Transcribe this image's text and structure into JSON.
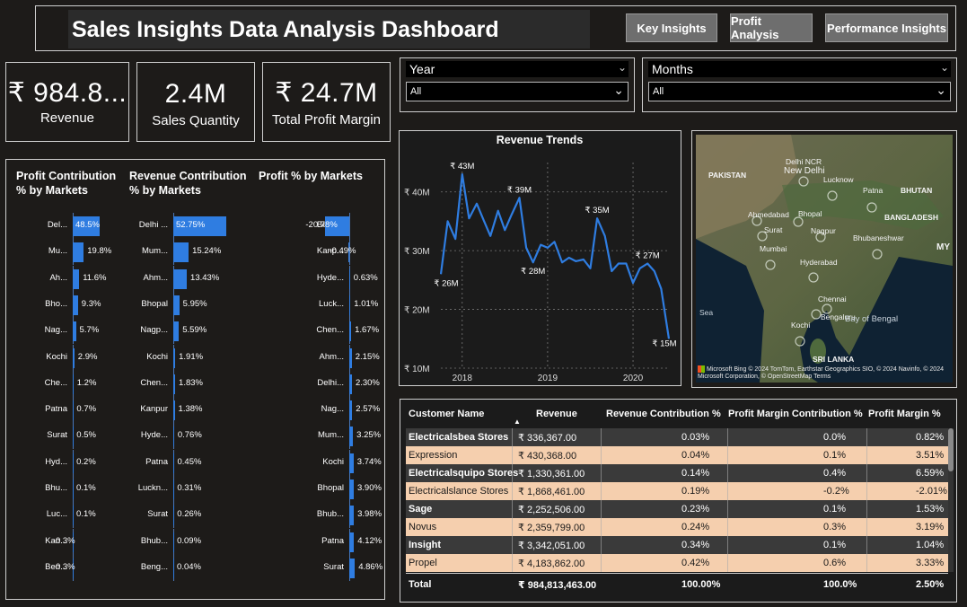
{
  "header": {
    "title": "Sales Insights Data Analysis Dashboard",
    "buttons": [
      "Key Insights",
      "Profit Analysis",
      "Performance Insights"
    ]
  },
  "kpis": [
    {
      "value": "₹ 984.8...",
      "label": "Revenue"
    },
    {
      "value": "2.4M",
      "label": "Sales Quantity"
    },
    {
      "value": "₹ 24.7M",
      "label": "Total Profit Margin"
    }
  ],
  "slicers": {
    "year": {
      "label": "Year",
      "value": "All"
    },
    "months": {
      "label": "Months",
      "value": "All"
    }
  },
  "bar_charts": {
    "profit_contribution": {
      "title_line1": "Profit Contribution",
      "title_line2": "% by Markets",
      "rows": [
        {
          "cat": "Del...",
          "label": "48.5%",
          "value": 48.5
        },
        {
          "cat": "Mu...",
          "label": "19.8%",
          "value": 19.8
        },
        {
          "cat": "Ah...",
          "label": "11.6%",
          "value": 11.6
        },
        {
          "cat": "Bho...",
          "label": "9.3%",
          "value": 9.3
        },
        {
          "cat": "Nag...",
          "label": "5.7%",
          "value": 5.7
        },
        {
          "cat": "Kochi",
          "label": "2.9%",
          "value": 2.9
        },
        {
          "cat": "Che...",
          "label": "1.2%",
          "value": 1.2
        },
        {
          "cat": "Patna",
          "label": "0.7%",
          "value": 0.7
        },
        {
          "cat": "Surat",
          "label": "0.5%",
          "value": 0.5
        },
        {
          "cat": "Hyd...",
          "label": "0.2%",
          "value": 0.2
        },
        {
          "cat": "Bhu...",
          "label": "0.1%",
          "value": 0.1
        },
        {
          "cat": "Luc...",
          "label": "0.1%",
          "value": 0.1
        },
        {
          "cat": "Kan...",
          "label": "-0.3%",
          "value": -0.3
        },
        {
          "cat": "Ben...",
          "label": "-0.3%",
          "value": -0.3
        }
      ]
    },
    "revenue_contribution": {
      "title_line1": "Revenue Contribution",
      "title_line2": "% by Markets",
      "rows": [
        {
          "cat": "Delhi ...",
          "label": "52.75%",
          "value": 52.75
        },
        {
          "cat": "Mum...",
          "label": "15.24%",
          "value": 15.24
        },
        {
          "cat": "Ahm...",
          "label": "13.43%",
          "value": 13.43
        },
        {
          "cat": "Bhopal",
          "label": "5.95%",
          "value": 5.95
        },
        {
          "cat": "Nagp...",
          "label": "5.59%",
          "value": 5.59
        },
        {
          "cat": "Kochi",
          "label": "1.91%",
          "value": 1.91
        },
        {
          "cat": "Chen...",
          "label": "1.83%",
          "value": 1.83
        },
        {
          "cat": "Kanpur",
          "label": "1.38%",
          "value": 1.38
        },
        {
          "cat": "Hyde...",
          "label": "0.76%",
          "value": 0.76
        },
        {
          "cat": "Patna",
          "label": "0.45%",
          "value": 0.45
        },
        {
          "cat": "Luckn...",
          "label": "0.31%",
          "value": 0.31
        },
        {
          "cat": "Surat",
          "label": "0.26%",
          "value": 0.26
        },
        {
          "cat": "Bhub...",
          "label": "0.09%",
          "value": 0.09
        },
        {
          "cat": "Beng...",
          "label": "0.04%",
          "value": 0.04
        }
      ]
    },
    "profit_pct": {
      "title_line1": "Profit % by Markets",
      "title_line2": "",
      "rows": [
        {
          "cat": "Beng...",
          "label": "-20.78%",
          "value": -20.78
        },
        {
          "cat": "Kanp...",
          "label": "-0.49%",
          "value": -0.49
        },
        {
          "cat": "Hyde...",
          "label": "0.63%",
          "value": 0.63
        },
        {
          "cat": "Luck...",
          "label": "1.01%",
          "value": 1.01
        },
        {
          "cat": "Chen...",
          "label": "1.67%",
          "value": 1.67
        },
        {
          "cat": "Ahm...",
          "label": "2.15%",
          "value": 2.15
        },
        {
          "cat": "Delhi...",
          "label": "2.30%",
          "value": 2.3
        },
        {
          "cat": "Nag...",
          "label": "2.57%",
          "value": 2.57
        },
        {
          "cat": "Mum...",
          "label": "3.25%",
          "value": 3.25
        },
        {
          "cat": "Kochi",
          "label": "3.74%",
          "value": 3.74
        },
        {
          "cat": "Bhopal",
          "label": "3.90%",
          "value": 3.9
        },
        {
          "cat": "Bhub...",
          "label": "3.98%",
          "value": 3.98
        },
        {
          "cat": "Patna",
          "label": "4.12%",
          "value": 4.12
        },
        {
          "cat": "Surat",
          "label": "4.86%",
          "value": 4.86
        }
      ]
    }
  },
  "chart_data": {
    "type": "line",
    "title": "Revenue Trends",
    "x_ticks": [
      "2018",
      "2019",
      "2020"
    ],
    "y_ticks": [
      "₹ 10M",
      "₹ 20M",
      "₹ 30M",
      "₹ 40M"
    ],
    "ylim": [
      10,
      45
    ],
    "xlim": [
      2017.75,
      2020.42
    ],
    "color": "#2f7de1",
    "series": [
      {
        "values": [
          [
            2017.75,
            26
          ],
          [
            2017.83,
            35
          ],
          [
            2017.92,
            32
          ],
          [
            2018.0,
            43
          ],
          [
            2018.08,
            35.5
          ],
          [
            2018.17,
            38
          ],
          [
            2018.25,
            35.2
          ],
          [
            2018.33,
            32.5
          ],
          [
            2018.42,
            36.8
          ],
          [
            2018.5,
            33.5
          ],
          [
            2018.58,
            36.2
          ],
          [
            2018.67,
            39
          ],
          [
            2018.75,
            30.5
          ],
          [
            2018.83,
            28
          ],
          [
            2018.92,
            31
          ],
          [
            2019.0,
            30.5
          ],
          [
            2019.08,
            31.5
          ],
          [
            2019.17,
            28
          ],
          [
            2019.25,
            28.8
          ],
          [
            2019.33,
            28.2
          ],
          [
            2019.42,
            28.5
          ],
          [
            2019.5,
            27
          ],
          [
            2019.58,
            35.5
          ],
          [
            2019.67,
            32.5
          ],
          [
            2019.75,
            26.5
          ],
          [
            2019.83,
            27.8
          ],
          [
            2019.92,
            27.8
          ],
          [
            2020.0,
            24.5
          ],
          [
            2020.08,
            27
          ],
          [
            2020.17,
            27.8
          ],
          [
            2020.25,
            26.5
          ],
          [
            2020.33,
            23.5
          ],
          [
            2020.42,
            15
          ]
        ]
      }
    ],
    "annotations": [
      {
        "x": 2017.75,
        "y": 26,
        "label": "₹ 26M",
        "pos": "below"
      },
      {
        "x": 2018.0,
        "y": 43,
        "label": "₹ 43M",
        "pos": "above"
      },
      {
        "x": 2018.67,
        "y": 39,
        "label": "₹ 39M",
        "pos": "above"
      },
      {
        "x": 2018.83,
        "y": 28,
        "label": "₹ 28M",
        "pos": "below"
      },
      {
        "x": 2019.58,
        "y": 35.5,
        "label": "₹ 35M",
        "pos": "above"
      },
      {
        "x": 2020.17,
        "y": 27.8,
        "label": "₹ 27M",
        "pos": "above"
      },
      {
        "x": 2020.42,
        "y": 15,
        "label": "₹ 15M",
        "pos": "below"
      }
    ]
  },
  "map": {
    "labels": [
      "PAKISTAN",
      "Delhi NCR",
      "New Delhi",
      "Lucknow",
      "Patna",
      "BHUTAN",
      "Ahmedabad",
      "Bhopal",
      "BANGLADESH",
      "Surat",
      "Nagpur",
      "Mumbai",
      "Bhubaneshwar",
      "Hyderabad",
      "Chennai",
      "Bengaluru",
      "Kochi",
      "Bay of Bengal",
      "Sea",
      "SRI LANKA",
      "MY"
    ],
    "attribution": "© 2024 TomTom, Earthstar Geographics SIO, © 2024 Navinfo, © 2024 Microsoft Corporation, © OpenStreetMap",
    "terms": "Terms",
    "bing": "Microsoft Bing"
  },
  "table": {
    "columns": [
      "Customer Name",
      "Revenue",
      "Revenue Contribution %",
      "Profit Margin Contribution %",
      "Profit Margin %"
    ],
    "rows": [
      [
        "Electricalsbea Stores",
        "₹ 336,367.00",
        "0.03%",
        "0.0%",
        "0.82%"
      ],
      [
        "Expression",
        "₹ 430,368.00",
        "0.04%",
        "0.1%",
        "3.51%"
      ],
      [
        "Electricalsquipo Stores",
        "₹ 1,330,361.00",
        "0.14%",
        "0.4%",
        "6.59%"
      ],
      [
        "Electricalslance Stores",
        "₹ 1,868,461.00",
        "0.19%",
        "-0.2%",
        "-2.01%"
      ],
      [
        "Sage",
        "₹ 2,252,506.00",
        "0.23%",
        "0.1%",
        "1.53%"
      ],
      [
        "Novus",
        "₹ 2,359,799.00",
        "0.24%",
        "0.3%",
        "3.19%"
      ],
      [
        "Insight",
        "₹ 3,342,051.00",
        "0.34%",
        "0.1%",
        "1.04%"
      ],
      [
        "Propel",
        "₹ 4,183,862.00",
        "0.42%",
        "0.6%",
        "3.33%"
      ]
    ],
    "total": [
      "Total",
      "₹ 984,813,463.00",
      "100.00%",
      "100.0%",
      "2.50%"
    ],
    "row_colors": [
      "#3a3a3a",
      "#f5cfae"
    ]
  }
}
